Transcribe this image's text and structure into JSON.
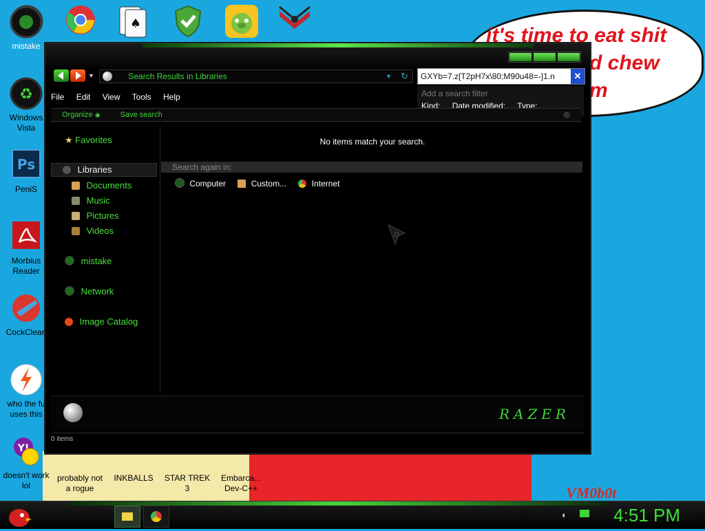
{
  "desktop": {
    "top_icons": [
      "razer-icon",
      "chrome-icon",
      "solitaire-icon",
      "shield-icon",
      "angry-birds-pig-icon",
      "emblem-icon"
    ],
    "icons": [
      {
        "name": "desktop-icon-mistake",
        "label": "mistake",
        "icon": "razer-icon"
      },
      {
        "name": "desktop-icon-windows-vista",
        "label": "Windows Vista",
        "icon": "recycle-icon"
      },
      {
        "name": "desktop-icon-penis",
        "label": "PeniS",
        "icon": "photoshop-icon"
      },
      {
        "name": "desktop-icon-morbius",
        "label": "Morbius Reader",
        "icon": "pdf-icon"
      },
      {
        "name": "desktop-icon-cockclean",
        "label": "CockClean",
        "icon": "cleaner-icon"
      },
      {
        "name": "desktop-icon-who",
        "label": "who the fu uses this",
        "icon": "lightning-icon"
      },
      {
        "name": "desktop-icon-yahoo",
        "label": "doesn't work lol",
        "icon": "yahoo-icon"
      },
      {
        "name": "desktop-icon-rogue",
        "label": "probably not a rogue",
        "icon": "game-icon"
      },
      {
        "name": "desktop-icon-inkballs",
        "label": "INKBALLS",
        "icon": "ink-icon"
      },
      {
        "name": "desktop-icon-startrek",
        "label": "STAR TREK 3",
        "icon": "starwars-icon"
      },
      {
        "name": "desktop-icon-devcpp",
        "label": "Embarca... Dev-C++",
        "icon": "cpp-icon"
      }
    ],
    "wallpaper_text": [
      "it's time to eat shit",
      "d chew",
      "m"
    ],
    "signature": "VM0b0t",
    "colors": {
      "sky": "#1aa7e0",
      "accent_green": "#3fd43a",
      "bubble_text": "#e0141c"
    }
  },
  "window": {
    "address": "Search Results in Libraries",
    "search": {
      "value": "GXYb=7.z[T2pH7x\\80;M90u48=-]1.n",
      "placeholder": "Add a search filter",
      "filters": [
        "Kind:",
        "Date modified:",
        "Type:"
      ]
    },
    "menu": [
      "File",
      "Edit",
      "View",
      "Tools",
      "Help"
    ],
    "toolbar": {
      "organize": "Organize",
      "save_search": "Save search"
    },
    "sidebar": {
      "favorites": "Favorites",
      "libraries": "Libraries",
      "library_items": [
        "Documents",
        "Music",
        "Pictures",
        "Videos"
      ],
      "user": "mistake",
      "network": "Network",
      "image_catalog": "Image Catalog"
    },
    "main": {
      "empty_message": "No items match your search.",
      "search_again": "Search again in:",
      "locations": [
        "Computer",
        "Custom...",
        "Internet"
      ]
    },
    "logo": "RAZER",
    "status": "0 items"
  },
  "taskbar": {
    "clock": "4:51 PM",
    "items": [
      "explorer-taskbar-button",
      "chrome-taskbar-button"
    ]
  }
}
